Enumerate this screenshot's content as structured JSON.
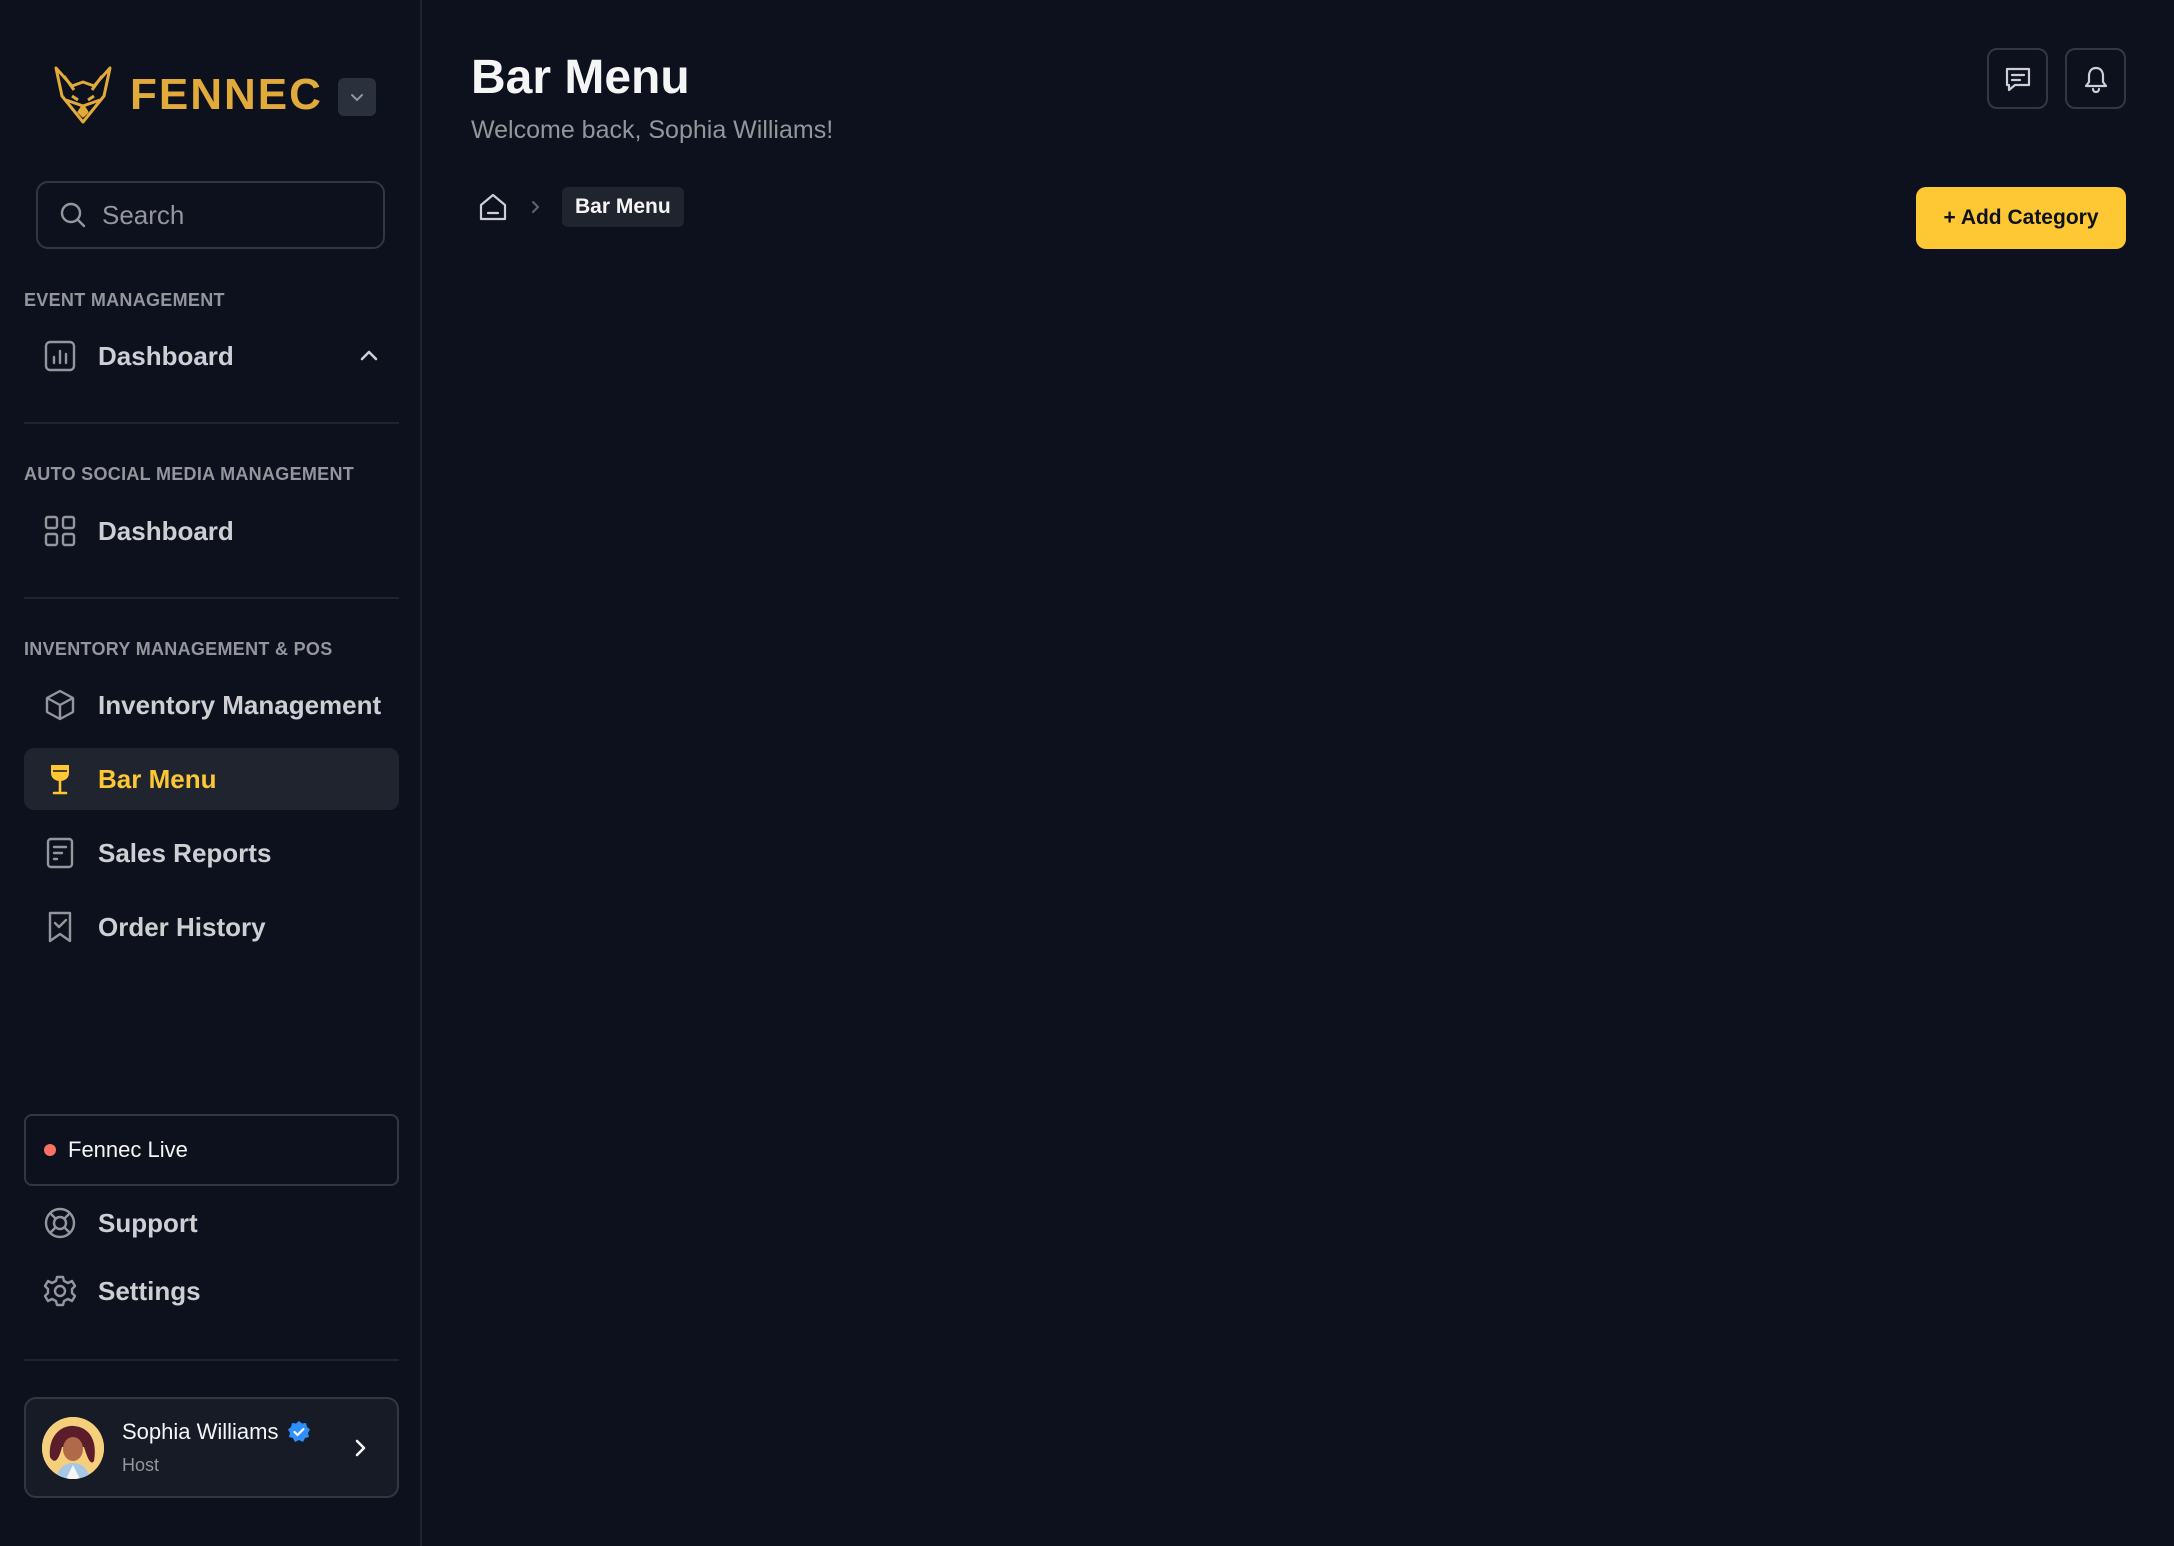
{
  "brand": {
    "name": "FENNEC",
    "accent": "#e2a93b"
  },
  "search": {
    "placeholder": "Search",
    "value": ""
  },
  "sidebar": {
    "sections": [
      {
        "label": "EVENT MANAGEMENT",
        "items": [
          {
            "label": "Dashboard",
            "icon": "bar-chart-icon",
            "expanded": true
          }
        ]
      },
      {
        "label": "AUTO SOCIAL MEDIA MANAGEMENT",
        "items": [
          {
            "label": "Dashboard",
            "icon": "grid-icon"
          }
        ]
      },
      {
        "label": "INVENTORY MANAGEMENT & POS",
        "items": [
          {
            "label": "Inventory Management",
            "icon": "cube-icon"
          },
          {
            "label": "Bar Menu",
            "icon": "wine-glass-icon",
            "active": true
          },
          {
            "label": "Sales Reports",
            "icon": "report-icon"
          },
          {
            "label": "Order History",
            "icon": "bookmark-check-icon"
          }
        ]
      }
    ],
    "live": {
      "label": "Fennec Live",
      "status_color": "#f97066"
    },
    "footer_items": [
      {
        "label": "Support",
        "icon": "life-buoy-icon"
      },
      {
        "label": "Settings",
        "icon": "gear-icon"
      }
    ],
    "user": {
      "name": "Sophia Williams",
      "role": "Host",
      "verified": true
    }
  },
  "header": {
    "title": "Bar Menu",
    "subtitle": "Welcome back, Sophia Williams!",
    "actions": [
      {
        "icon": "message-icon"
      },
      {
        "icon": "bell-icon"
      }
    ]
  },
  "breadcrumb": {
    "current": "Bar Menu"
  },
  "toolbar": {
    "add_label": "+ Add Category"
  },
  "colors": {
    "background": "#0c111d",
    "active_accent": "#fdc833",
    "button": "#fdc833"
  }
}
